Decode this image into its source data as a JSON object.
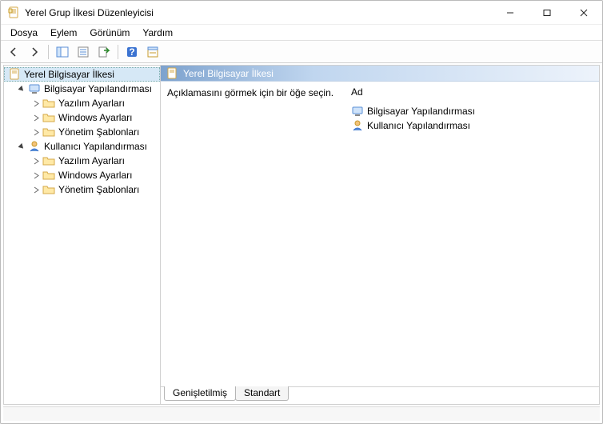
{
  "window": {
    "title": "Yerel Grup İlkesi Düzenleyicisi"
  },
  "menu": {
    "file": "Dosya",
    "action": "Eylem",
    "view": "Görünüm",
    "help": "Yardım"
  },
  "tree": {
    "root": "Yerel Bilgisayar İlkesi",
    "computer_cfg": "Bilgisayar Yapılandırması",
    "user_cfg": "Kullanıcı Yapılandırması",
    "software_settings": "Yazılım Ayarları",
    "windows_settings": "Windows Ayarları",
    "admin_templates": "Yönetim Şablonları"
  },
  "right": {
    "header": "Yerel Bilgisayar İlkesi",
    "description": "Açıklamasını görmek için bir öğe seçin.",
    "column_name": "Ad",
    "items": {
      "computer": "Bilgisayar Yapılandırması",
      "user": "Kullanıcı Yapılandırması"
    }
  },
  "tabs": {
    "extended": "Genişletilmiş",
    "standard": "Standart"
  }
}
